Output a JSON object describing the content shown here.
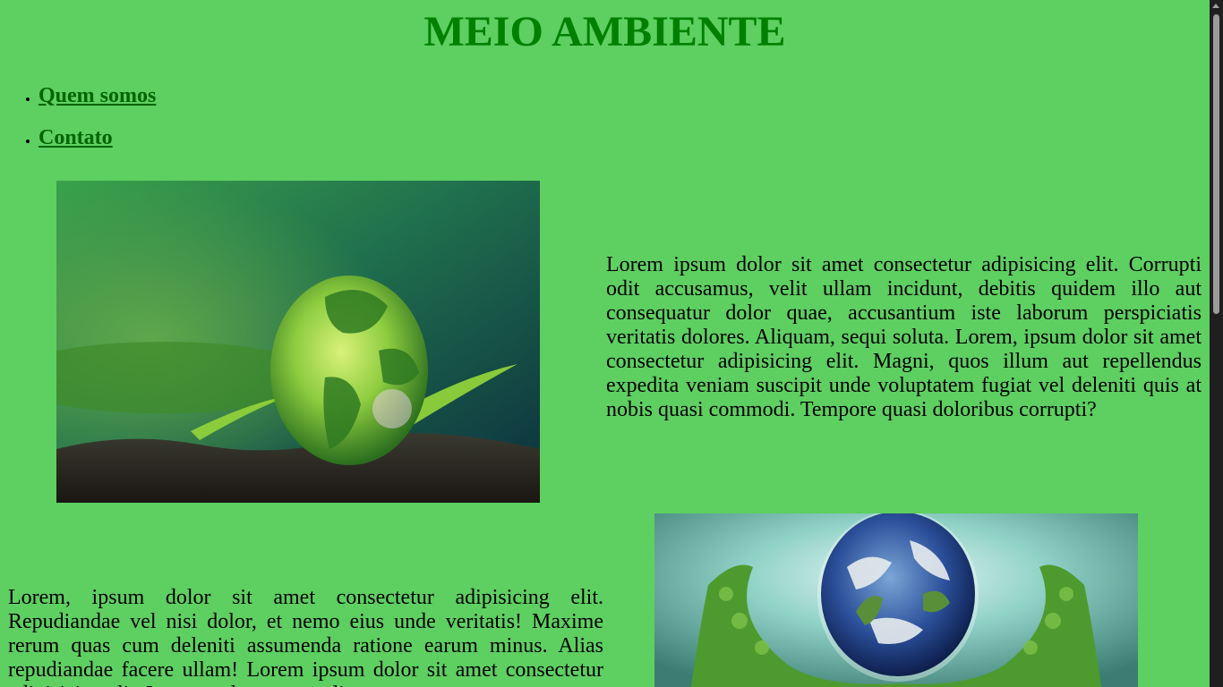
{
  "header": {
    "title": "MEIO AMBIENTE"
  },
  "nav": {
    "items": [
      {
        "label": "Quem somos"
      },
      {
        "label": "Contato"
      }
    ]
  },
  "section1": {
    "image": "earth-globe-on-soil-with-fern-photo",
    "text": "Lorem ipsum dolor sit amet consectetur adipisicing elit. Corrupti odit accusamus, velit ullam incidunt, debitis quidem illo aut consequatur dolor quae, accusantium iste laborum perspiciatis veritatis dolores. Aliquam, sequi soluta. Lorem, ipsum dolor sit amet consectetur adipisicing elit. Magni, quos illum aut repellendus expedita veniam suscipit unde voluptatem fugiat vel deleniti quis at nobis quasi commodi. Tempore quasi doloribus corrupti?"
  },
  "section2": {
    "image": "earth-globe-held-by-leafy-hands-photo",
    "text": "Lorem, ipsum dolor sit amet consectetur adipisicing elit. Repudiandae vel nisi dolor, et nemo eius unde veritatis! Maxime rerum quas cum deleniti assumenda ratione earum minus. Alias repudiandae facere ullam! Lorem ipsum dolor sit amet consectetur adipisicing elit. Ipsam, voluptatum velit."
  },
  "colors": {
    "background": "#5ecf61",
    "title": "#008000",
    "link": "#006400"
  }
}
